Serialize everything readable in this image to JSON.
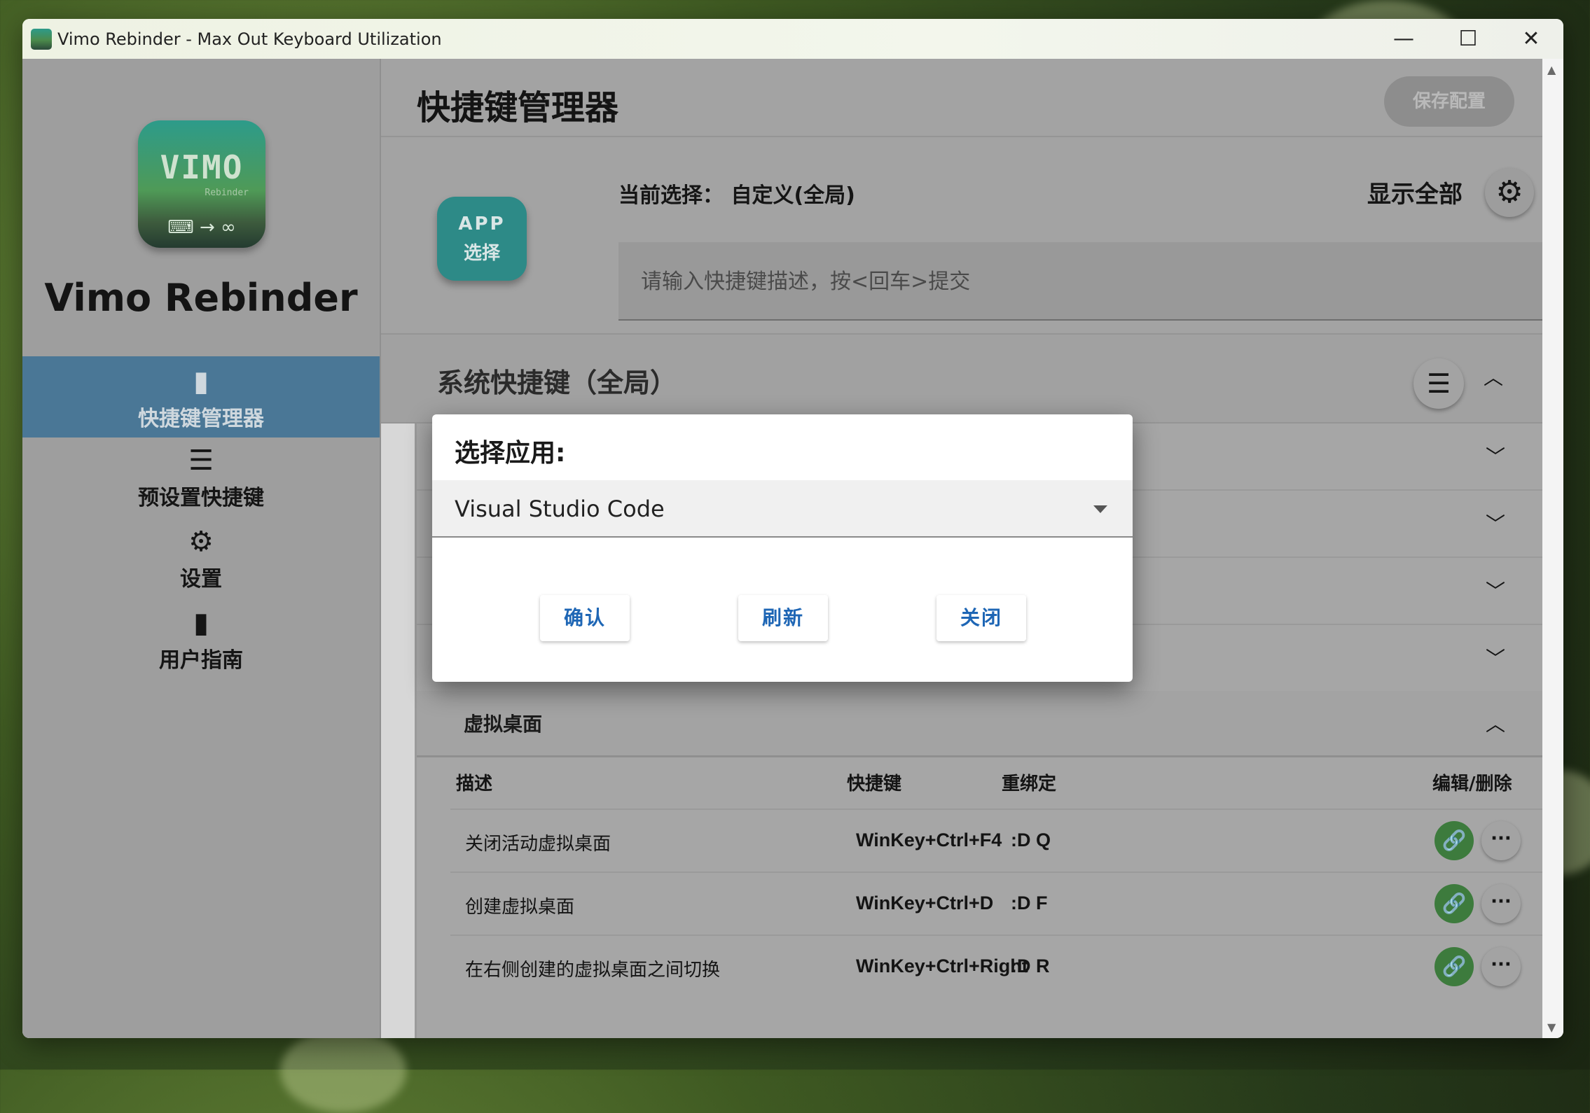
{
  "window": {
    "title": "Vimo Rebinder - Max Out Keyboard Utilization",
    "controls": {
      "minimize": "—",
      "maximize": "☐",
      "close": "✕"
    }
  },
  "sidebar": {
    "logo": {
      "word": "VIMO",
      "sub": "Rebinder",
      "bottom": "⌨ → ∞"
    },
    "app_name": "Vimo Rebinder",
    "items": [
      {
        "label": "快捷键管理器",
        "icon": "bookmark-icon",
        "active": true
      },
      {
        "label": "预设置快捷键",
        "icon": "server-list-icon",
        "active": false
      },
      {
        "label": "设置",
        "icon": "gear-icon",
        "active": false
      },
      {
        "label": "用户指南",
        "icon": "book-icon",
        "active": false
      }
    ]
  },
  "header": {
    "title": "快捷键管理器",
    "save_label": "保存配置"
  },
  "selection": {
    "app_button": {
      "line1": "APP",
      "line2": "选择"
    },
    "current_label": "当前选择：",
    "current_value": "自定义(全局)",
    "show_all": "显示全部",
    "search_placeholder": "请输入快捷键描述，按<回车>提交"
  },
  "section": {
    "title": "系统快捷键（全局）"
  },
  "virtual_desktop": {
    "title": "虚拟桌面",
    "columns": [
      "描述",
      "快捷键",
      "重绑定",
      "编辑/删除"
    ],
    "rows": [
      {
        "desc": "关闭活动虚拟桌面",
        "key": "WinKey+Ctrl+F4",
        "rebind": ":D Q"
      },
      {
        "desc": "创建虚拟桌面",
        "key": "WinKey+Ctrl+D",
        "rebind": ":D F"
      },
      {
        "desc": "在右侧创建的虚拟桌面之间切换",
        "key": "WinKey+Ctrl+Right",
        "rebind": ":D R"
      }
    ]
  },
  "dialog": {
    "title": "选择应用:",
    "selected_app": "Visual Studio Code",
    "confirm": "确认",
    "refresh": "刷新",
    "close": "关闭"
  },
  "colors": {
    "accent_nav": "#4a7796",
    "app_button": "#2d8a87",
    "link_button": "#3d7b3d",
    "dialog_button_text": "#1e66b5"
  }
}
